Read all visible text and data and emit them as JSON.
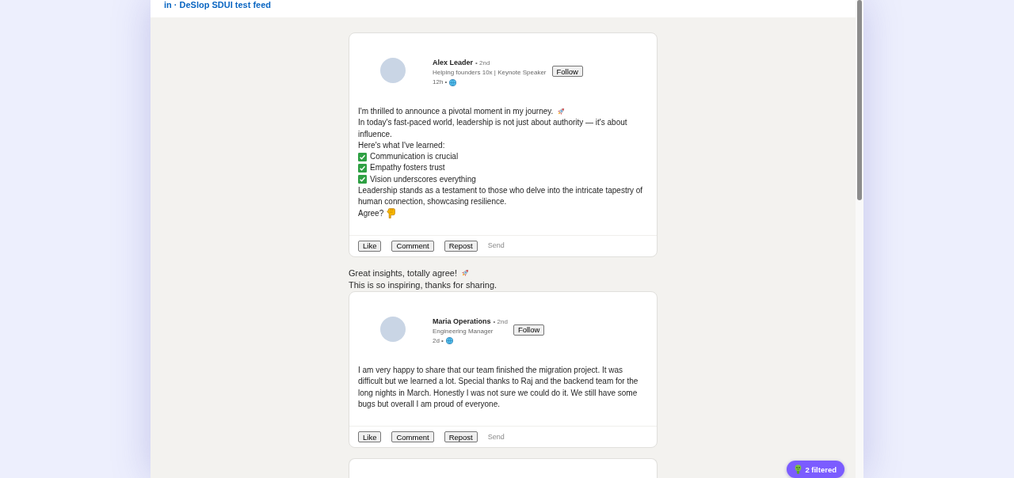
{
  "header": {
    "title": "in · DeSlop SDUI test feed"
  },
  "feed": [
    {
      "kind": "post",
      "author": {
        "name": "Alex Leader",
        "degree": "• 2nd",
        "headline": "Helping founders 10x | Keynote Speaker",
        "time": "12h •"
      },
      "follow_label": "Follow",
      "body": [
        {
          "kind": "rocket",
          "text": "I'm thrilled to announce a pivotal moment in my journey."
        },
        {
          "kind": "plain",
          "text": "In today's fast-paced world, leadership is not just about authority — it's about influence."
        },
        {
          "kind": "plain",
          "text": "Here's what I've learned:"
        },
        {
          "kind": "check",
          "text": "Communication is crucial"
        },
        {
          "kind": "check",
          "text": "Empathy fosters trust"
        },
        {
          "kind": "check",
          "text": "Vision underscores everything"
        },
        {
          "kind": "plain",
          "text": "Leadership stands as a testament to those who delve into the intricate tapestry of human connection, showcasing resilience."
        },
        {
          "kind": "pointer",
          "text": "Agree?"
        }
      ],
      "actions": [
        {
          "kind": "button",
          "label": "Like"
        },
        {
          "kind": "button",
          "label": "Comment"
        },
        {
          "kind": "button",
          "label": "Repost"
        },
        {
          "kind": "link",
          "label": "Send"
        }
      ]
    },
    {
      "kind": "comments",
      "items": [
        {
          "kind": "rocket",
          "text": "Great insights, totally agree!"
        },
        {
          "kind": "plain",
          "text": "This is so inspiring, thanks for sharing."
        }
      ]
    },
    {
      "kind": "post",
      "author": {
        "name": "Maria Operations",
        "degree": "• 2nd",
        "headline": "Engineering Manager",
        "time": "2d •"
      },
      "follow_label": "Follow",
      "body": [
        {
          "kind": "plain",
          "text": "I am very happy to share that our team finished the migration project. It was difficult but we learned a lot. Special thanks to Raj and the backend team for the long nights in March. Honestly I was not sure we could do it. We still have some bugs but overall I am proud of everyone."
        }
      ],
      "actions": [
        {
          "kind": "button",
          "label": "Like"
        },
        {
          "kind": "button",
          "label": "Comment"
        },
        {
          "kind": "button",
          "label": "Repost"
        },
        {
          "kind": "link",
          "label": "Send"
        }
      ]
    },
    {
      "kind": "stub"
    }
  ],
  "filter_badge": {
    "label": "2 filtered"
  }
}
